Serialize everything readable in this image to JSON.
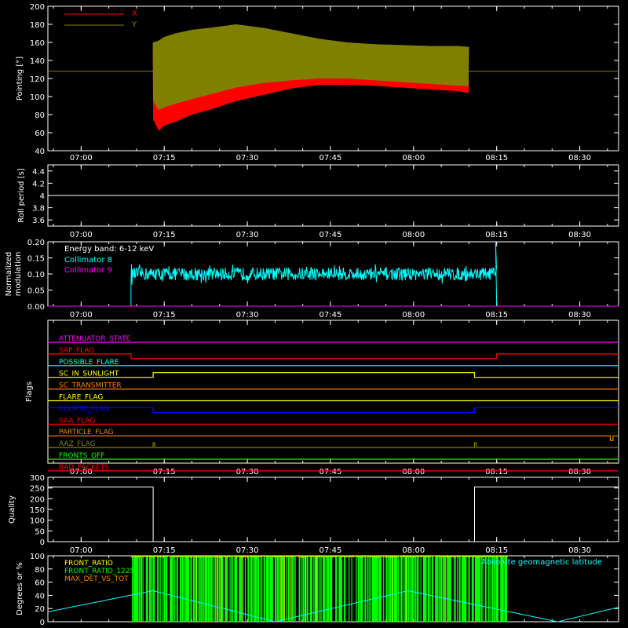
{
  "chart_data": [
    {
      "type": "line",
      "ylabel": "Pointing [°]",
      "ylim": [
        40,
        200
      ],
      "yticks": [
        40,
        60,
        80,
        100,
        120,
        140,
        160,
        180,
        200
      ],
      "xticks": [
        "07:00",
        "07:15",
        "07:30",
        "07:45",
        "08:00",
        "08:15",
        "08:30"
      ],
      "xlim": [
        "06:54",
        "08:37"
      ],
      "legend": {
        "placement": "top-left",
        "entries": [
          {
            "name": "X",
            "color": "#ff0000"
          },
          {
            "name": "Y",
            "color": "#808000"
          }
        ]
      },
      "reference_line": {
        "y": 128,
        "color": "#808000"
      },
      "series": [
        {
          "name": "X",
          "color": "#ff0000",
          "t_minutes": [
            0,
            1,
            2,
            4,
            7,
            10,
            15,
            20,
            25,
            30,
            35,
            40,
            45,
            50,
            55,
            57
          ],
          "low": [
            75,
            62,
            68,
            72,
            80,
            85,
            95,
            102,
            109,
            113,
            113,
            112,
            110,
            108,
            106,
            104
          ],
          "high": [
            150,
            118,
            115,
            115,
            120,
            125,
            130,
            132,
            130,
            128,
            126,
            124,
            122,
            120,
            118,
            118
          ]
        },
        {
          "name": "Y",
          "color": "#808000",
          "t_minutes": [
            0,
            1,
            2,
            4,
            7,
            10,
            15,
            20,
            25,
            30,
            35,
            40,
            45,
            50,
            55,
            57
          ],
          "low": [
            95,
            85,
            88,
            92,
            97,
            102,
            110,
            115,
            118,
            120,
            120,
            118,
            116,
            114,
            112,
            112
          ],
          "high": [
            160,
            162,
            166,
            170,
            174,
            176,
            180,
            176,
            170,
            164,
            160,
            158,
            157,
            156,
            156,
            155
          ]
        }
      ]
    },
    {
      "type": "line",
      "ylabel": "Roll period [s]",
      "ylim": [
        3.5,
        4.5
      ],
      "yticks": [
        3.6,
        3.8,
        4.0,
        4.2,
        4.4
      ],
      "xticks": [
        "07:00",
        "07:15",
        "07:30",
        "07:45",
        "08:00",
        "08:15",
        "08:30"
      ],
      "series": [
        {
          "color": "#ffffff",
          "x": [
            "06:54",
            "08:37"
          ],
          "y": [
            4.0,
            4.0
          ]
        }
      ]
    },
    {
      "type": "line",
      "ylabel": "Normalized modulation",
      "ylim": [
        0.0,
        0.2
      ],
      "yticks": [
        "0.00",
        "0.05",
        "0.10",
        "0.15",
        "0.20"
      ],
      "xticks": [
        "07:00",
        "07:15",
        "07:30",
        "07:45",
        "08:00",
        "08:15",
        "08:30"
      ],
      "annotation": "Energy band: 6-12 keV",
      "legend": {
        "placement": "top-left",
        "entries": [
          {
            "name": "Collimator 8",
            "color": "#00ffff"
          },
          {
            "name": "Collimator 9",
            "color": "#ff00ff"
          }
        ]
      },
      "series": [
        {
          "name": "Collimator 8",
          "color": "#00ffff",
          "start": "07:09",
          "end": "08:15",
          "level": 0.1,
          "noise": 0.02,
          "spike": {
            "x": "08:14.8",
            "y": 0.2
          }
        },
        {
          "name": "Collimator 9",
          "color": "#ff00ff",
          "x": [
            "06:54",
            "08:37"
          ],
          "y": [
            0.0,
            0.0
          ]
        }
      ]
    },
    {
      "type": "line",
      "ylabel": "Flags",
      "xticks": [
        "07:00",
        "07:15",
        "07:30",
        "07:45",
        "08:00",
        "08:15",
        "08:30"
      ],
      "flags": [
        {
          "name": "ATTENUATOR_STATE",
          "color": "#ff00ff",
          "segments": [
            [
              "06:54",
              0
            ],
            [
              "08:37",
              0
            ]
          ]
        },
        {
          "name": "SAP_FLAG",
          "color": "#ff0000",
          "segments": [
            [
              "06:54",
              0
            ],
            [
              "07:09",
              0
            ],
            [
              "07:09",
              -1
            ],
            [
              "08:15",
              -1
            ],
            [
              "08:15",
              0
            ],
            [
              "08:37",
              0
            ]
          ]
        },
        {
          "name": "POSSIBLE_FLARE",
          "color": "#00ffff",
          "segments": [
            [
              "06:54",
              0
            ],
            [
              "08:37",
              0
            ]
          ]
        },
        {
          "name": "SC_IN_SUNLIGHT",
          "color": "#ffff00",
          "segments": [
            [
              "06:54",
              0
            ],
            [
              "07:13",
              0
            ],
            [
              "07:13",
              1
            ],
            [
              "08:11",
              1
            ],
            [
              "08:11",
              0
            ],
            [
              "08:37",
              0
            ]
          ]
        },
        {
          "name": "SC_TRANSMITTER",
          "color": "#ff8000",
          "segments": [
            [
              "06:54",
              0
            ],
            [
              "08:37",
              0
            ]
          ]
        },
        {
          "name": "FLARE_FLAG",
          "color": "#ffff00",
          "segments": [
            [
              "06:54",
              0
            ],
            [
              "08:37",
              0
            ]
          ]
        },
        {
          "name": "ECLIPSE_FLAG",
          "color": "#0000ff",
          "segments": [
            [
              "06:54",
              1
            ],
            [
              "07:13",
              1
            ],
            [
              "07:13",
              0
            ],
            [
              "08:11",
              0
            ],
            [
              "08:11",
              1
            ],
            [
              "08:37",
              1
            ]
          ]
        },
        {
          "name": "SAA_FLAG",
          "color": "#ff0000",
          "segments": [
            [
              "06:54",
              0
            ],
            [
              "08:37",
              0
            ]
          ]
        },
        {
          "name": "PARTICLE_FLAG",
          "color": "#ff8000",
          "segments": [
            [
              "06:54",
              0
            ],
            [
              "08:35.5",
              0
            ],
            [
              "08:35.5",
              -1
            ],
            [
              "08:36",
              -1
            ],
            [
              "08:36",
              0
            ],
            [
              "08:37",
              0
            ]
          ]
        },
        {
          "name": "AAZ_FLAG",
          "color": "#808000",
          "segments": [
            [
              "06:54",
              0
            ],
            [
              "07:13",
              0
            ],
            [
              "07:13",
              1
            ],
            [
              "07:13.3",
              1
            ],
            [
              "07:13.3",
              0
            ],
            [
              "08:11",
              0
            ],
            [
              "08:11",
              1
            ],
            [
              "08:11.3",
              1
            ],
            [
              "08:11.3",
              0
            ],
            [
              "08:37",
              0
            ]
          ]
        },
        {
          "name": "FRONTS_OFF",
          "color": "#00ff00",
          "segments": [
            [
              "06:54",
              0
            ],
            [
              "08:37",
              0
            ]
          ]
        },
        {
          "name": "BAD_PACKETS",
          "color": "#ff0000",
          "segments": [
            [
              "06:54",
              0
            ],
            [
              "08:37",
              0
            ]
          ]
        }
      ]
    },
    {
      "type": "line",
      "ylabel": "Quality",
      "ylim": [
        0,
        300
      ],
      "yticks": [
        0,
        50,
        100,
        150,
        200,
        250,
        300
      ],
      "xticks": [
        "07:00",
        "07:15",
        "07:30",
        "07:45",
        "08:00",
        "08:15",
        "08:30"
      ],
      "series": [
        {
          "color": "#ffffff",
          "x": [
            "06:54",
            "07:13",
            "07:13",
            "08:11",
            "08:11",
            "08:37"
          ],
          "y": [
            255,
            255,
            0,
            0,
            255,
            255
          ]
        }
      ]
    },
    {
      "type": "line",
      "ylabel": "Degrees or %",
      "ylim": [
        0,
        100
      ],
      "yticks": [
        0,
        20,
        40,
        60,
        80,
        100
      ],
      "legend": {
        "placement": "top-left",
        "entries": [
          {
            "name": "FRONT_RATIO",
            "color": "#ffff00"
          },
          {
            "name": "FRONT_RATIO_1225",
            "color": "#00ff00"
          },
          {
            "name": "MAX_DET_VS_TOT",
            "color": "#ff8000"
          }
        ]
      },
      "annotation": "Absolute geomagnetic latitude",
      "series": [
        {
          "name": "Absolute geomagnetic latitude",
          "color": "#00ffff",
          "x": [
            "06:54",
            "07:13",
            "07:35",
            "07:59",
            "08:26",
            "08:37"
          ],
          "y": [
            15,
            47,
            0,
            47,
            0,
            22
          ]
        },
        {
          "name": "FRONT_RATIO_1225",
          "color": "#00ff00",
          "start": "07:09",
          "end": "08:17",
          "level": 100,
          "dropouts": 70
        },
        {
          "name": "FRONT_RATIO",
          "color": "#ffff00",
          "start": "07:09",
          "end": "08:17",
          "level": 100
        }
      ]
    }
  ]
}
